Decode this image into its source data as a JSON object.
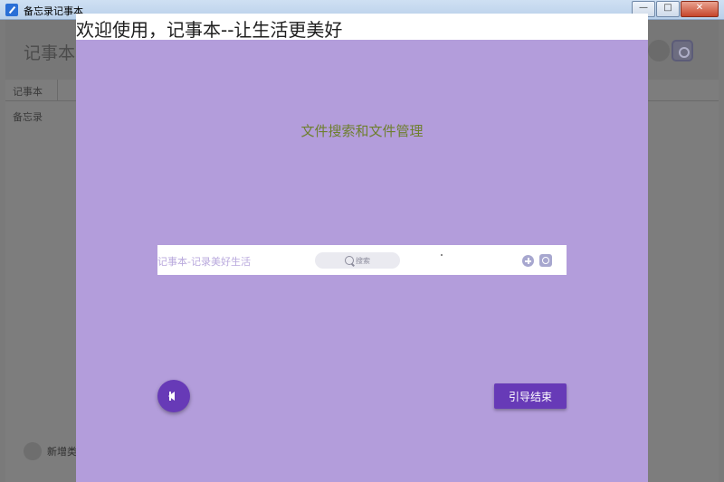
{
  "window": {
    "title": "备忘录记事本",
    "controls": [
      "minimize",
      "maximize",
      "close"
    ]
  },
  "background_app": {
    "logo": "记事本",
    "tabs": [
      {
        "label": "记事本"
      }
    ],
    "sidebar_item": "备忘录",
    "add_label": "新增类"
  },
  "guide": {
    "title": "欢迎使用，记事本--让生活更美好",
    "subtitle": "文件搜索和文件管理",
    "preview": {
      "logo": "记事本-记录美好生活",
      "search_label": "搜索"
    },
    "finish_button": "引导结束"
  },
  "colors": {
    "overlay": "#b39ddb",
    "accent": "#673ab7",
    "subtitle": "#6e7f2e"
  }
}
